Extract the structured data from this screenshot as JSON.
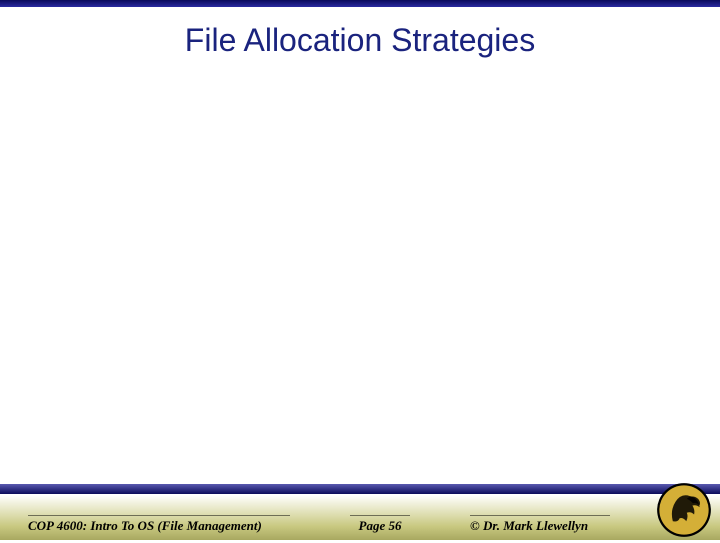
{
  "slide": {
    "title": "File Allocation Strategies"
  },
  "footer": {
    "course": "COP 4600: Intro To OS  (File Management)",
    "page": "Page 56",
    "author": "© Dr. Mark Llewellyn"
  }
}
